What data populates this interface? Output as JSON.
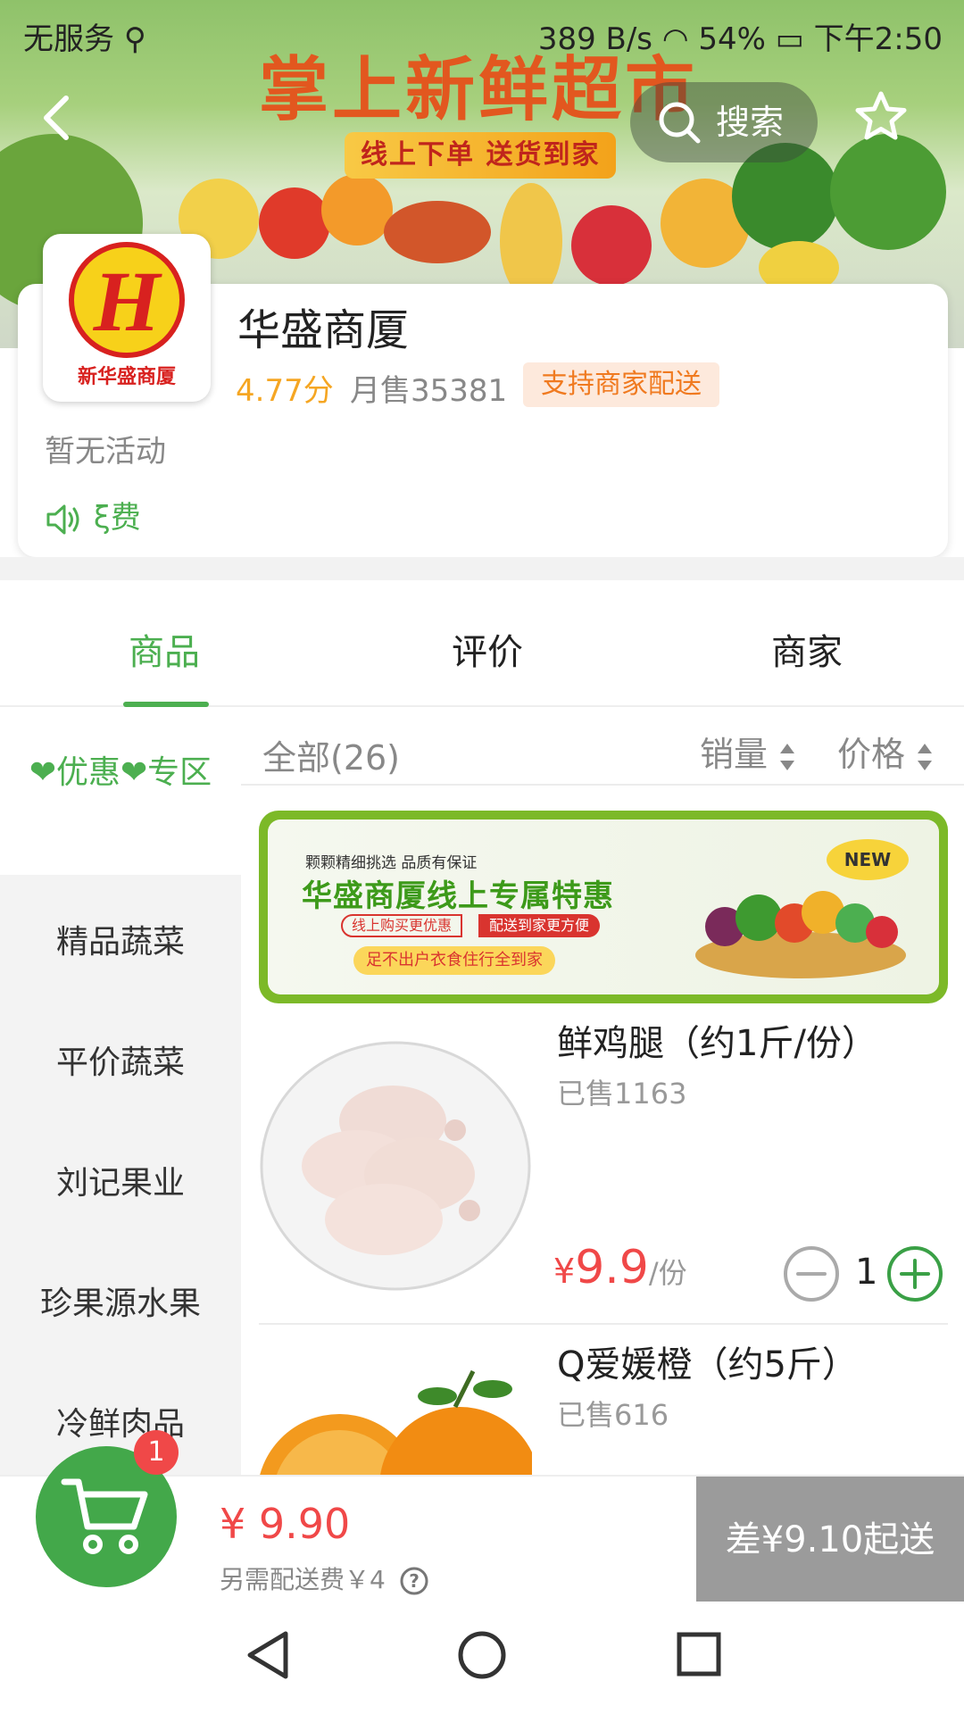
{
  "status_bar": {
    "carrier": "无服务",
    "usb_icon": "usb-icon",
    "net_speed": "389 B/s",
    "battery": "54%",
    "time": "下午2:50"
  },
  "banner": {
    "title": "掌上新鲜超市",
    "subtitle": "线上下单  送货到家"
  },
  "header": {
    "search_label": "搜索"
  },
  "shop": {
    "logo_text": "新华盛商厦",
    "name": "华盛商厦",
    "score": "4.77分",
    "monthly_sales": "月售35381",
    "delivery_tag": "支持商家配送",
    "activity": "暂无活动",
    "notice": "ξ费"
  },
  "tabs": [
    {
      "label": "商品"
    },
    {
      "label": "评价"
    },
    {
      "label": "商家"
    }
  ],
  "categories": [
    {
      "label": "❤优惠❤专区"
    },
    {
      "label": "精品蔬菜"
    },
    {
      "label": "平价蔬菜"
    },
    {
      "label": "刘记果业"
    },
    {
      "label": "珍果源水果"
    },
    {
      "label": "冷鲜肉品"
    }
  ],
  "sortbar": {
    "all": "全部(26)",
    "sales": "销量",
    "price": "价格"
  },
  "promo": {
    "small": "颗颗精细挑选 品质有保证",
    "title": "华盛商厦线上专属特惠",
    "tag1": "线上购买更优惠",
    "tag2": "配送到家更方便",
    "tag3": "足不出户衣食住行全到家",
    "new_badge": "NEW"
  },
  "products": [
    {
      "name": "鲜鸡腿（约1斤/份）",
      "sold": "已售1163",
      "currency": "¥",
      "price": "9.9",
      "unit": "/份",
      "qty": "1"
    },
    {
      "name": "Q爱媛橙（约5斤）",
      "sold": "已售616"
    }
  ],
  "cart": {
    "badge": "1",
    "total": "¥ 9.90",
    "fee_note": "另需配送费￥4",
    "checkout": "差¥9.10起送"
  },
  "colors": {
    "accent": "#4caf50",
    "price": "#f04848",
    "score": "#f5a623"
  }
}
